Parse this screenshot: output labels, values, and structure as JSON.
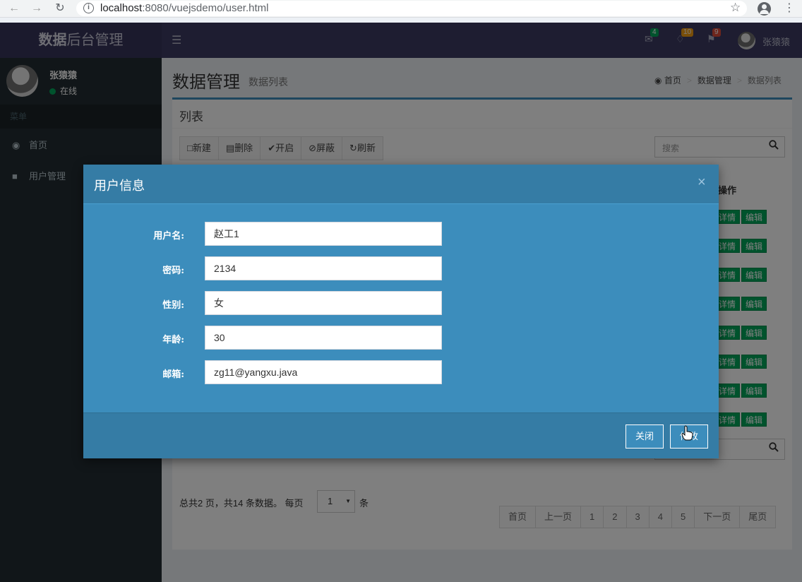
{
  "browser": {
    "url_host": "localhost",
    "url_rest": ":8080/vuejsdemo/user.html"
  },
  "header": {
    "logo_bold": "数据",
    "logo_rest": "后台管理",
    "mail_count": "4",
    "bell_count": "10",
    "flag_count": "9",
    "user_name": "张猿猿",
    "colors": {
      "mail_badge": "#00a65a",
      "bell_badge": "#f39c12",
      "flag_badge": "#dd4b39"
    }
  },
  "sidebar": {
    "user_name": "张猿猿",
    "status": "在线",
    "menu_header": "菜单",
    "items": [
      {
        "label": "首页",
        "icon": "dashboard-icon"
      },
      {
        "label": "用户管理",
        "icon": "folder-icon"
      }
    ]
  },
  "content": {
    "title": "数据管理",
    "subtitle": "数据列表",
    "breadcrumb": [
      "首页",
      "数据管理",
      "数据列表"
    ],
    "box_title": "列表",
    "toolbar": [
      "新建",
      "删除",
      "开启",
      "屏蔽",
      "刷新"
    ],
    "search_placeholder": "搜索",
    "ops_header": "操作",
    "row_actions": {
      "detail": "详情",
      "edit": "编辑"
    },
    "row_count": 8,
    "pager": {
      "info": "总共2 页，共14 条数据。 每页",
      "per_page": "1",
      "unit": "条",
      "pages": [
        "首页",
        "上一页",
        "1",
        "2",
        "3",
        "4",
        "5",
        "下一页",
        "尾页"
      ]
    }
  },
  "modal": {
    "title": "用户信息",
    "close": "×",
    "fields": [
      {
        "label": "用户名:",
        "value": "赵工1"
      },
      {
        "label": "密码:",
        "value": "2134"
      },
      {
        "label": "性别:",
        "value": "女"
      },
      {
        "label": "年龄:",
        "value": "30"
      },
      {
        "label": "邮箱:",
        "value": "zg11@yangxu.java"
      }
    ],
    "close_button": "关闭",
    "submit_button": "修改"
  }
}
